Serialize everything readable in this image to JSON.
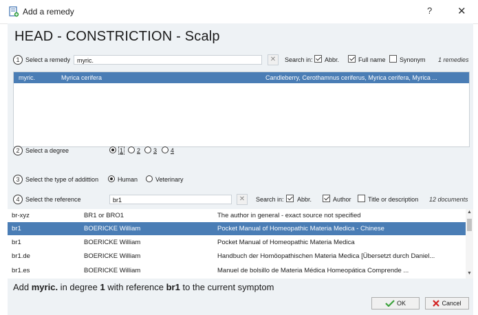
{
  "window": {
    "title": "Add a remedy",
    "help": "?",
    "close": "✕"
  },
  "heading": "HEAD - CONSTRICTION - Scalp",
  "remedy": {
    "step": "1",
    "label": "Select a remedy",
    "value": "myric.",
    "clear": "✕",
    "search_in": "Search in:",
    "opt_abbr": "Abbr.",
    "opt_fullname": "Full name",
    "opt_synonym": "Synonym",
    "count": "1 remedies",
    "rows": [
      {
        "abbr": "myric.",
        "name": "Myrica cerifera",
        "synonyms": "Candleberry, Cerothamnus ceriferus, Myrica cerifera, Myrica ..."
      }
    ]
  },
  "degree": {
    "step": "2",
    "label": "Select a degree",
    "options": [
      "1",
      "2",
      "3",
      "4"
    ],
    "selected": "1"
  },
  "addition": {
    "step": "3",
    "label": "Select the type of addittion",
    "options": [
      "Human",
      "Veterinary"
    ],
    "selected": "Human"
  },
  "reference": {
    "step": "4",
    "label": "Select the reference",
    "value": "br1",
    "clear": "✕",
    "search_in": "Search in:",
    "opt_abbr": "Abbr.",
    "opt_author": "Author",
    "opt_title": "Title or description",
    "count": "12 documents",
    "rows": [
      {
        "code": "br-xyz",
        "author": "BR1 or BRO1",
        "title": "The author in general - exact source not specified"
      },
      {
        "code": "br1",
        "author": "BOERICKE William",
        "title": "Pocket Manual of Homeopathic Materia Medica - Chinese"
      },
      {
        "code": "br1",
        "author": "BOERICKE William",
        "title": "Pocket Manual of Homeopathic Materia Medica"
      },
      {
        "code": "br1.de",
        "author": "BOERICKE William",
        "title": "Handbuch der Homöopathischen Materia Medica [Übersetzt durch Daniel..."
      },
      {
        "code": "br1.es",
        "author": "BOERICKE William",
        "title": "Manuel de bolsillo de Materia Médica Homeopática Comprende ..."
      }
    ]
  },
  "summary": {
    "prefix": "Add ",
    "remedy": "myric.",
    "mid1": " in degree ",
    "degree": "1",
    "mid2": " with reference ",
    "reference": "br1",
    "suffix": " to the current symptom"
  },
  "buttons": {
    "ok": "OK",
    "cancel": "Cancel"
  },
  "colors": {
    "selection": "#4a7db5",
    "panel": "#eef2f5",
    "ok_icon": "#3aa23a",
    "cancel_icon": "#d22020"
  }
}
